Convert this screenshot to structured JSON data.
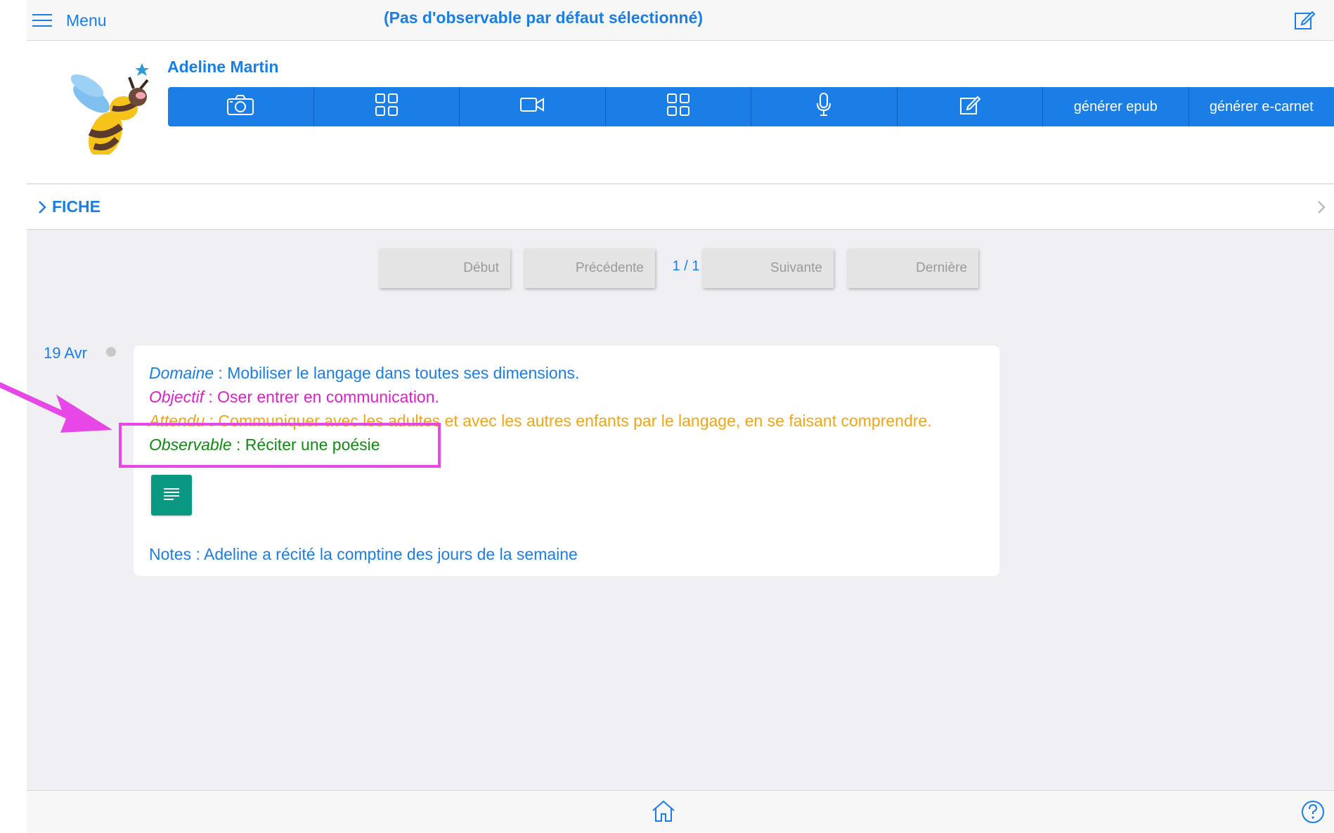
{
  "header": {
    "menu_label": "Menu",
    "title": "(Pas d'observable par défaut sélectionné)"
  },
  "student": {
    "name": "Adeline Martin"
  },
  "toolbar": {
    "buttons": [
      {
        "icon": "camera-icon"
      },
      {
        "icon": "grid-icon"
      },
      {
        "icon": "video-icon"
      },
      {
        "icon": "grid-icon"
      },
      {
        "icon": "microphone-icon"
      },
      {
        "icon": "edit-icon"
      },
      {
        "label": "générer epub"
      },
      {
        "label": "générer e-carnet"
      }
    ]
  },
  "fiche": {
    "label": "FICHE"
  },
  "pager": {
    "first": "Début",
    "prev": "Précédente",
    "count": "1 / 1",
    "next": "Suivante",
    "last": "Dernière"
  },
  "entry": {
    "date": "19 Avr",
    "domaine_label": "Domaine",
    "domaine_value": " : Mobiliser le langage dans toutes ses dimensions.",
    "objectif_label": "Objectif",
    "objectif_value": " : Oser entrer en communication.",
    "attendu_label": "Attendu",
    "attendu_value": " : Communiquer avec les adultes et avec les autres enfants par le langage, en se faisant comprendre.",
    "observable_label": "Observable",
    "observable_value": " : Réciter une poésie",
    "notes": "Notes : Adeline a récité la comptine des jours de la semaine"
  },
  "colors": {
    "accent": "#1a7ee6",
    "objectif": "#e020c8",
    "attendu": "#f0a614",
    "observable": "#108a10",
    "doc_button": "#0a9883",
    "annotation": "#e647e6"
  }
}
